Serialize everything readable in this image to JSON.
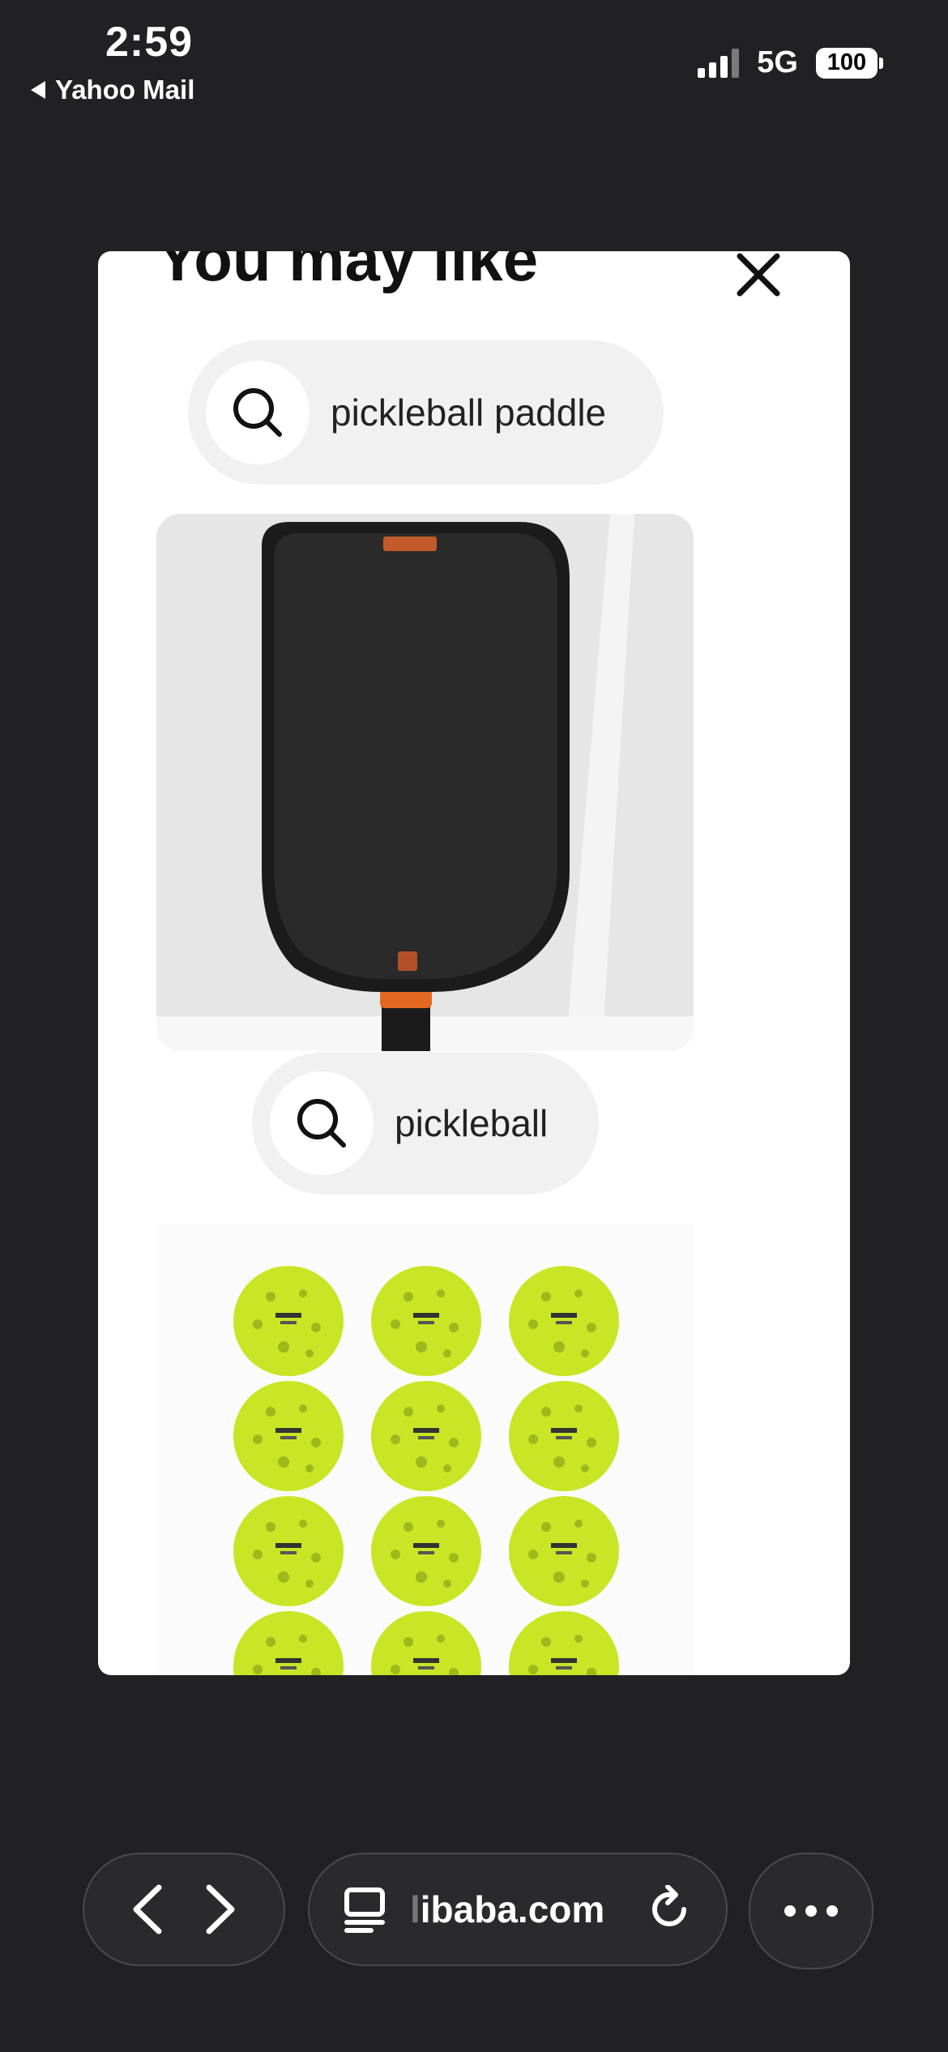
{
  "status_bar": {
    "time": "2:59",
    "back_app": "Yahoo Mail",
    "network": "5G",
    "battery": "100"
  },
  "modal": {
    "title": "You may like",
    "suggestions": [
      {
        "label": "pickleball paddle",
        "icon": "search-icon"
      },
      {
        "label": "pickleball",
        "icon": "search-icon"
      }
    ]
  },
  "toolbar": {
    "url_prefix": "l",
    "url_main": "ibaba.com",
    "icons": [
      "chevron-left-icon",
      "chevron-right-icon",
      "tabs-icon",
      "reload-icon",
      "more-icon"
    ]
  },
  "colors": {
    "background": "#212123",
    "modal": "#ffffff",
    "chip": "#f1f1f1",
    "ball": "#c8e625"
  }
}
